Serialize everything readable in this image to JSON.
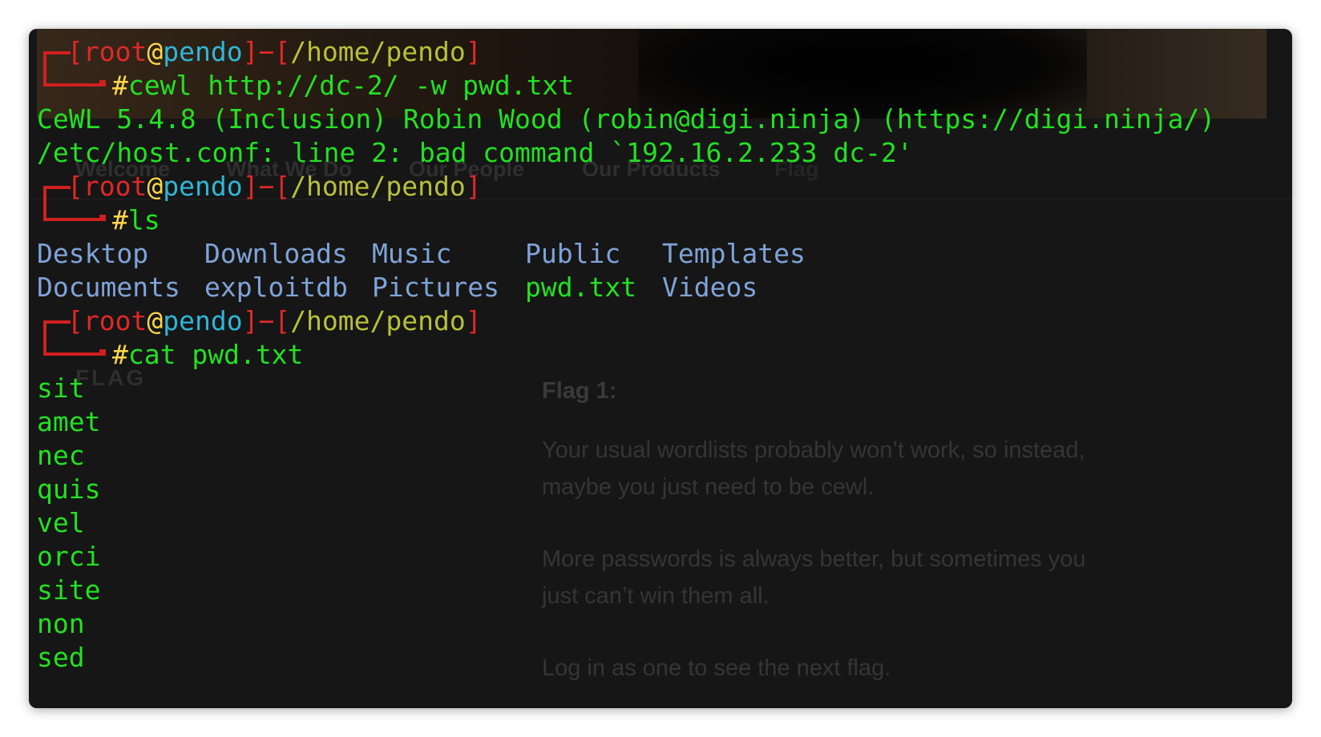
{
  "background_site": {
    "nav": [
      "Welcome",
      "What We Do",
      "Our People",
      "Our Products",
      "Flag"
    ],
    "section_heading": "FLAG",
    "flag_title": "Flag 1:",
    "paragraphs": [
      "Your usual wordlists probably won’t work, so instead,",
      "maybe you just need to be cewl.",
      "More passwords is always better, but sometimes you",
      "just can’t win them all.",
      "Log in as one to see the next flag."
    ]
  },
  "prompt": {
    "open_bracket": "[",
    "user": "root",
    "at": "@",
    "host": "pendo",
    "separator": "]−[",
    "cwd": "/home/pendo",
    "close_bracket": "]",
    "hash": "#"
  },
  "commands": [
    "cewl http://dc-2/ -w pwd.txt",
    "ls",
    "cat pwd.txt"
  ],
  "cewl_output": [
    "CeWL 5.4.8 (Inclusion) Robin Wood (robin@digi.ninja) (https://digi.ninja/)",
    "/etc/host.conf: line 2: bad command `192.16.2.233 dc-2'"
  ],
  "ls_output": {
    "row1": [
      "Desktop",
      "Downloads",
      "Music",
      "Public",
      "Templates"
    ],
    "row2": [
      "Documents",
      "exploitdb",
      "Pictures",
      "pwd.txt",
      "Videos"
    ]
  },
  "wordlist": [
    "sit",
    "amet",
    "nec",
    "quis",
    "vel",
    "orci",
    "site",
    "non",
    "sed"
  ],
  "colors": {
    "terminal_bg": "#161616",
    "prompt_red": "#e02828",
    "prompt_yellow": "#ffd84a",
    "prompt_cyan": "#2fb6d8",
    "path_olive": "#b8c03a",
    "output_green": "#24e024",
    "directory_blue": "#7fa3d8"
  }
}
